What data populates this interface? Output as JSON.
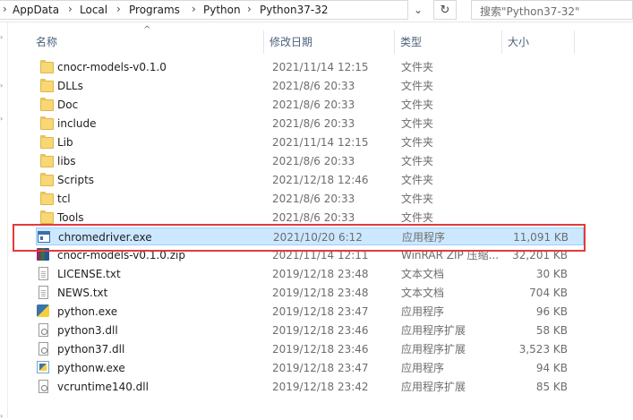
{
  "address_bar": {
    "breadcrumbs": [
      "AppData",
      "Local",
      "Programs",
      "Python",
      "Python37-32"
    ],
    "separator": "›",
    "dropdown_glyph": "⌄",
    "refresh_glyph": "↻"
  },
  "search": {
    "placeholder": "搜索\"Python37-32\""
  },
  "columns": {
    "name": "名称",
    "date": "修改日期",
    "type": "类型",
    "size": "大小",
    "sort_indicator": "^"
  },
  "files": [
    {
      "name": "cnocr-models-v0.1.0",
      "date": "2021/11/14 12:15",
      "type": "文件夹",
      "size": "",
      "icon": "folder-icon",
      "kind": "folder"
    },
    {
      "name": "DLLs",
      "date": "2021/8/6 20:33",
      "type": "文件夹",
      "size": "",
      "icon": "folder-icon",
      "kind": "folder"
    },
    {
      "name": "Doc",
      "date": "2021/8/6 20:33",
      "type": "文件夹",
      "size": "",
      "icon": "folder-icon",
      "kind": "folder"
    },
    {
      "name": "include",
      "date": "2021/8/6 20:33",
      "type": "文件夹",
      "size": "",
      "icon": "folder-icon",
      "kind": "folder"
    },
    {
      "name": "Lib",
      "date": "2021/11/14 12:15",
      "type": "文件夹",
      "size": "",
      "icon": "folder-icon",
      "kind": "folder"
    },
    {
      "name": "libs",
      "date": "2021/8/6 20:33",
      "type": "文件夹",
      "size": "",
      "icon": "folder-icon",
      "kind": "folder"
    },
    {
      "name": "Scripts",
      "date": "2021/12/18 12:46",
      "type": "文件夹",
      "size": "",
      "icon": "folder-icon",
      "kind": "folder"
    },
    {
      "name": "tcl",
      "date": "2021/8/6 20:33",
      "type": "文件夹",
      "size": "",
      "icon": "folder-icon",
      "kind": "folder"
    },
    {
      "name": "Tools",
      "date": "2021/8/6 20:33",
      "type": "文件夹",
      "size": "",
      "icon": "folder-icon",
      "kind": "folder"
    },
    {
      "name": "chromedriver.exe",
      "date": "2021/10/20 6:12",
      "type": "应用程序",
      "size": "11,091 KB",
      "icon": "application-icon",
      "kind": "appexe",
      "selected": true
    },
    {
      "name": "cnocr-models-v0.1.0.zip",
      "date": "2021/11/14 12:11",
      "type": "WinRAR ZIP 压缩...",
      "size": "32,201 KB",
      "icon": "winrar-archive-icon",
      "kind": "rar"
    },
    {
      "name": "LICENSE.txt",
      "date": "2019/12/18 23:48",
      "type": "文本文档",
      "size": "30 KB",
      "icon": "text-document-icon",
      "kind": "doc"
    },
    {
      "name": "NEWS.txt",
      "date": "2019/12/18 23:48",
      "type": "文本文档",
      "size": "704 KB",
      "icon": "text-document-icon",
      "kind": "doc"
    },
    {
      "name": "python.exe",
      "date": "2019/12/18 23:47",
      "type": "应用程序",
      "size": "96 KB",
      "icon": "python-icon",
      "kind": "pyexe"
    },
    {
      "name": "python3.dll",
      "date": "2019/12/18 23:46",
      "type": "应用程序扩展",
      "size": "58 KB",
      "icon": "dll-icon",
      "kind": "dll"
    },
    {
      "name": "python37.dll",
      "date": "2019/12/18 23:46",
      "type": "应用程序扩展",
      "size": "3,523 KB",
      "icon": "dll-icon",
      "kind": "dll"
    },
    {
      "name": "pythonw.exe",
      "date": "2019/12/18 23:47",
      "type": "应用程序",
      "size": "94 KB",
      "icon": "pythonw-icon",
      "kind": "pywexe"
    },
    {
      "name": "vcruntime140.dll",
      "date": "2019/12/18 23:42",
      "type": "应用程序扩展",
      "size": "85 KB",
      "icon": "dll-icon",
      "kind": "dll"
    }
  ],
  "colors": {
    "selection_bg": "#cce8ff",
    "selection_border": "#99d1ff",
    "annotation_red": "#e23b3b",
    "header_text": "#4c607a"
  }
}
